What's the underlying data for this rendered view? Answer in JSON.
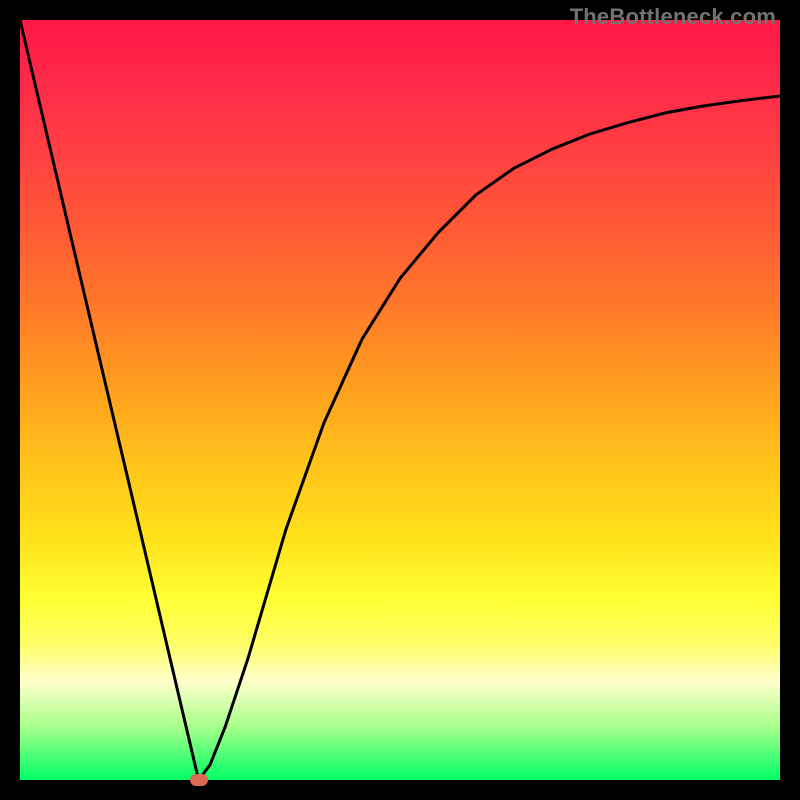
{
  "watermark": "TheBottleneck.com",
  "chart_data": {
    "type": "line",
    "title": "",
    "xlabel": "",
    "ylabel": "",
    "xlim": [
      0,
      100
    ],
    "ylim": [
      0,
      100
    ],
    "grid": false,
    "legend": false,
    "series": [
      {
        "name": "curve",
        "x": [
          0,
          5,
          10,
          15,
          20,
          23.5,
          25,
          27,
          30,
          35,
          40,
          45,
          50,
          55,
          60,
          65,
          70,
          75,
          80,
          85,
          90,
          95,
          100
        ],
        "y": [
          100,
          78.7,
          57.4,
          36.2,
          14.9,
          0,
          2,
          7,
          16,
          33,
          47,
          58,
          66,
          72,
          77,
          80.5,
          83,
          85,
          86.5,
          87.8,
          88.7,
          89.4,
          90
        ]
      }
    ],
    "marker": {
      "x": 23.5,
      "y": 0
    },
    "gradient_colors": {
      "top": "#ff1744",
      "mid": "#ffcc00",
      "bottom": "#00ff66"
    }
  }
}
